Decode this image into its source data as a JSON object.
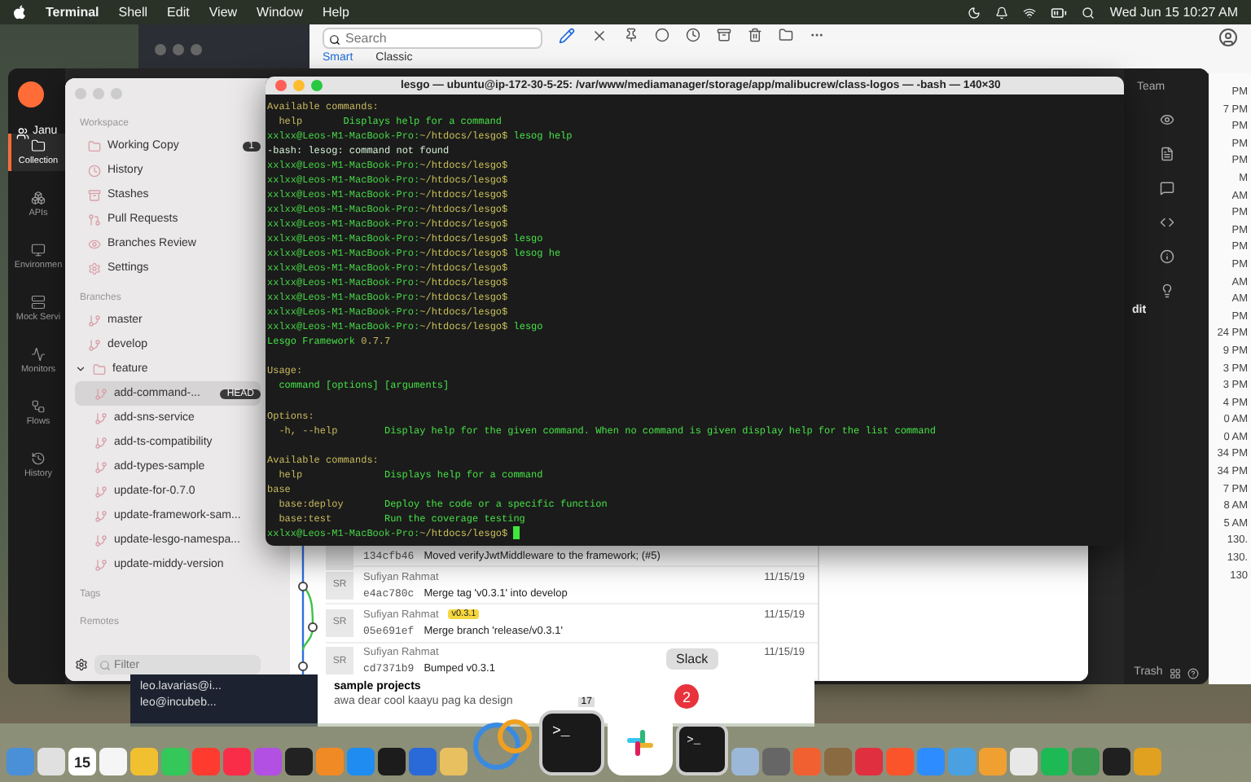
{
  "menu_bar": {
    "app": "Terminal",
    "items": [
      "Shell",
      "Edit",
      "View",
      "Window",
      "Help"
    ],
    "clock": "Wed Jun 15  10:27 AM"
  },
  "mail_window": {
    "search": {
      "placeholder": "Search"
    },
    "tabs": [
      {
        "label": "Smart",
        "selected": true
      },
      {
        "label": "Classic",
        "selected": false
      }
    ]
  },
  "postman": {
    "workspace": "Janu",
    "nav": [
      {
        "label": "Collection",
        "selected": true
      },
      {
        "label": "APIs",
        "selected": false
      },
      {
        "label": "Environmen",
        "selected": false
      },
      {
        "label": "Mock Servi",
        "selected": false
      },
      {
        "label": "Monitors",
        "selected": false
      },
      {
        "label": "Flows",
        "selected": false
      },
      {
        "label": "History",
        "selected": false
      }
    ],
    "team": "Team",
    "edit_fragment": "dit",
    "trash": "Trash"
  },
  "times_list": {
    "times": [
      "PM",
      "7 PM",
      "PM",
      "PM",
      "PM",
      "M",
      "AM",
      "PM",
      "PM",
      "PM",
      "PM",
      "AM",
      "AM",
      "PM",
      "24 PM",
      "9 PM",
      "3 PM",
      "3 PM",
      "4 PM",
      "0 AM",
      "0 AM",
      "34 PM",
      "34 PM",
      "7 PM",
      "8 AM",
      "5 AM"
    ],
    "cells": [
      "130.",
      "130.",
      "130"
    ]
  },
  "sourcetree": {
    "sidebar": {
      "workspace_heading": "Workspace",
      "workspace": [
        {
          "label": "Working Copy",
          "badge": "1",
          "selected": false
        },
        {
          "label": "History",
          "selected": false
        },
        {
          "label": "Stashes",
          "selected": false
        },
        {
          "label": "Pull Requests",
          "selected": false
        },
        {
          "label": "Branches Review",
          "selected": false
        },
        {
          "label": "Settings",
          "selected": false
        }
      ],
      "branches_heading": "Branches",
      "branches": [
        {
          "label": "master",
          "selected": false
        },
        {
          "label": "develop",
          "selected": false
        },
        {
          "label": "feature",
          "selected": false,
          "expanded": true,
          "children": [
            {
              "label": "add-command-...",
              "badge": "HEAD",
              "selected": true
            },
            {
              "label": "add-sns-service",
              "selected": false
            },
            {
              "label": "add-ts-compatibility",
              "selected": false
            },
            {
              "label": "add-types-sample",
              "selected": false
            },
            {
              "label": "update-for-0.7.0",
              "selected": false
            },
            {
              "label": "update-framework-sam...",
              "selected": false
            },
            {
              "label": "update-lesgo-namespa...",
              "selected": false
            },
            {
              "label": "update-middy-version",
              "selected": false
            }
          ]
        }
      ],
      "tags_heading": "Tags",
      "remotes_heading": "Remotes",
      "filter": {
        "placeholder": "Filter"
      }
    },
    "commits": [
      {
        "hash": "134cfb46",
        "message": "Moved verifyJwtMiddleware to the framework; (#5)"
      },
      {
        "initials": "SR",
        "author": "Sufiyan Rahmat",
        "date": "11/15/19",
        "hash": "e4ac780c",
        "message": "Merge tag 'v0.3.1' into develop"
      },
      {
        "initials": "SR",
        "author": "Sufiyan Rahmat",
        "tag": "v0.3.1",
        "date": "11/15/19",
        "hash": "05e691ef",
        "message": "Merge branch 'release/v0.3.1'"
      },
      {
        "initials": "SR",
        "author": "Sufiyan Rahmat",
        "date": "11/15/19",
        "hash": "cd7371b9",
        "message": "Bumped v0.3.1"
      }
    ]
  },
  "terminal": {
    "title": "lesgo — ubuntu@ip-172-30-5-25: /var/www/mediamanager/storage/app/malibucrew/class-logos — -bash — 140×30",
    "lines": [
      {
        "kind": "heading",
        "text": "Available commands:"
      },
      {
        "kind": "item_compact",
        "name": "help",
        "description": "Displays help for a command"
      },
      {
        "kind": "prompt",
        "host": "xxlxx@Leos-M1-MacBook-Pro:",
        "path": "~/htdocs/lesgo$",
        "command": "lesog help"
      },
      {
        "kind": "error",
        "text": "-bash: lesog: command not found"
      },
      {
        "kind": "prompt",
        "host": "xxlxx@Leos-M1-MacBook-Pro:",
        "path": "~/htdocs/lesgo$"
      },
      {
        "kind": "prompt",
        "host": "xxlxx@Leos-M1-MacBook-Pro:",
        "path": "~/htdocs/lesgo$"
      },
      {
        "kind": "prompt",
        "host": "xxlxx@Leos-M1-MacBook-Pro:",
        "path": "~/htdocs/lesgo$"
      },
      {
        "kind": "prompt",
        "host": "xxlxx@Leos-M1-MacBook-Pro:",
        "path": "~/htdocs/lesgo$"
      },
      {
        "kind": "prompt",
        "host": "xxlxx@Leos-M1-MacBook-Pro:",
        "path": "~/htdocs/lesgo$"
      },
      {
        "kind": "prompt",
        "host": "xxlxx@Leos-M1-MacBook-Pro:",
        "path": "~/htdocs/lesgo$",
        "command": "lesgo"
      },
      {
        "kind": "prompt",
        "host": "xxlxx@Leos-M1-MacBook-Pro:",
        "path": "~/htdocs/lesgo$",
        "command": "lesog he"
      },
      {
        "kind": "prompt",
        "host": "xxlxx@Leos-M1-MacBook-Pro:",
        "path": "~/htdocs/lesgo$"
      },
      {
        "kind": "prompt",
        "host": "xxlxx@Leos-M1-MacBook-Pro:",
        "path": "~/htdocs/lesgo$"
      },
      {
        "kind": "prompt",
        "host": "xxlxx@Leos-M1-MacBook-Pro:",
        "path": "~/htdocs/lesgo$"
      },
      {
        "kind": "prompt",
        "host": "xxlxx@Leos-M1-MacBook-Pro:",
        "path": "~/htdocs/lesgo$"
      },
      {
        "kind": "prompt",
        "host": "xxlxx@Leos-M1-MacBook-Pro:",
        "path": "~/htdocs/lesgo$",
        "command": "lesgo"
      },
      {
        "kind": "text",
        "text": "Lesgo Framework",
        "version": "0.7.7"
      },
      {
        "kind": "blank"
      },
      {
        "kind": "heading",
        "text": "Usage:"
      },
      {
        "kind": "text",
        "text": "  command [options] [arguments]"
      },
      {
        "kind": "blank"
      },
      {
        "kind": "heading",
        "text": "Options:"
      },
      {
        "kind": "item",
        "name": "-h, --help",
        "description": "Display help for the given command. When no command is given display help for the list command"
      },
      {
        "kind": "blank"
      },
      {
        "kind": "heading",
        "text": "Available commands:"
      },
      {
        "kind": "item",
        "name": "help",
        "description": "Displays help for a command"
      },
      {
        "kind": "heading",
        "text": "base"
      },
      {
        "kind": "item",
        "name": "base:deploy",
        "description": "Deploy the code or a specific function"
      },
      {
        "kind": "item",
        "name": "base:test",
        "description": "Run the coverage testing"
      },
      {
        "kind": "prompt",
        "host": "xxlxx@Leos-M1-MacBook-Pro:",
        "path": "~/htdocs/lesgo$",
        "cursor": true
      }
    ]
  },
  "accounts": [
    "leo.lavarias@i...",
    "leo@incubeb..."
  ],
  "note": {
    "title": "sample projects",
    "preview": "awa dear cool kaayu pag ka design",
    "count": "17"
  },
  "tooltip": "Slack",
  "dock": [
    {
      "kind": "app",
      "color": "#4a90d9"
    },
    {
      "kind": "app",
      "color": "#e0e0e0"
    },
    {
      "kind": "calendar",
      "label": "15"
    },
    {
      "kind": "app",
      "color": "#f5f5f5"
    },
    {
      "kind": "app",
      "color": "#f0c030"
    },
    {
      "kind": "app",
      "color": "#34c759"
    },
    {
      "kind": "app",
      "color": "#ff3b30"
    },
    {
      "kind": "app",
      "color": "#fa2d48"
    },
    {
      "kind": "app",
      "color": "#b150e2"
    },
    {
      "kind": "app",
      "color": "#222222"
    },
    {
      "kind": "app",
      "color": "#f08a24"
    },
    {
      "kind": "app",
      "color": "#1e8cf0"
    },
    {
      "kind": "app",
      "color": "#1c1c1c"
    },
    {
      "kind": "app",
      "color": "#2a6ad8"
    },
    {
      "kind": "app",
      "color": "#e8c060"
    },
    {
      "kind": "ring"
    },
    {
      "kind": "terminal",
      "label": ">_",
      "large": true
    },
    {
      "kind": "slack",
      "badge": "2",
      "large": true
    },
    {
      "kind": "terminal",
      "label": ">_",
      "large": false
    },
    {
      "kind": "app",
      "color": "#9bb8d8"
    },
    {
      "kind": "app",
      "color": "#666666"
    },
    {
      "kind": "app",
      "color": "#f06030"
    },
    {
      "kind": "app",
      "color": "#8a6a40"
    },
    {
      "kind": "app",
      "color": "#e03040"
    },
    {
      "kind": "app",
      "color": "#fb542b"
    },
    {
      "kind": "app",
      "color": "#2d8cff"
    },
    {
      "kind": "app",
      "color": "#4aa0e0"
    },
    {
      "kind": "app",
      "color": "#f0a030"
    },
    {
      "kind": "app",
      "color": "#e8e8e8"
    },
    {
      "kind": "app",
      "color": "#1db954"
    },
    {
      "kind": "app",
      "color": "#3a9a50"
    },
    {
      "kind": "app",
      "color": "#202020"
    },
    {
      "kind": "app",
      "color": "#e0a020"
    }
  ]
}
